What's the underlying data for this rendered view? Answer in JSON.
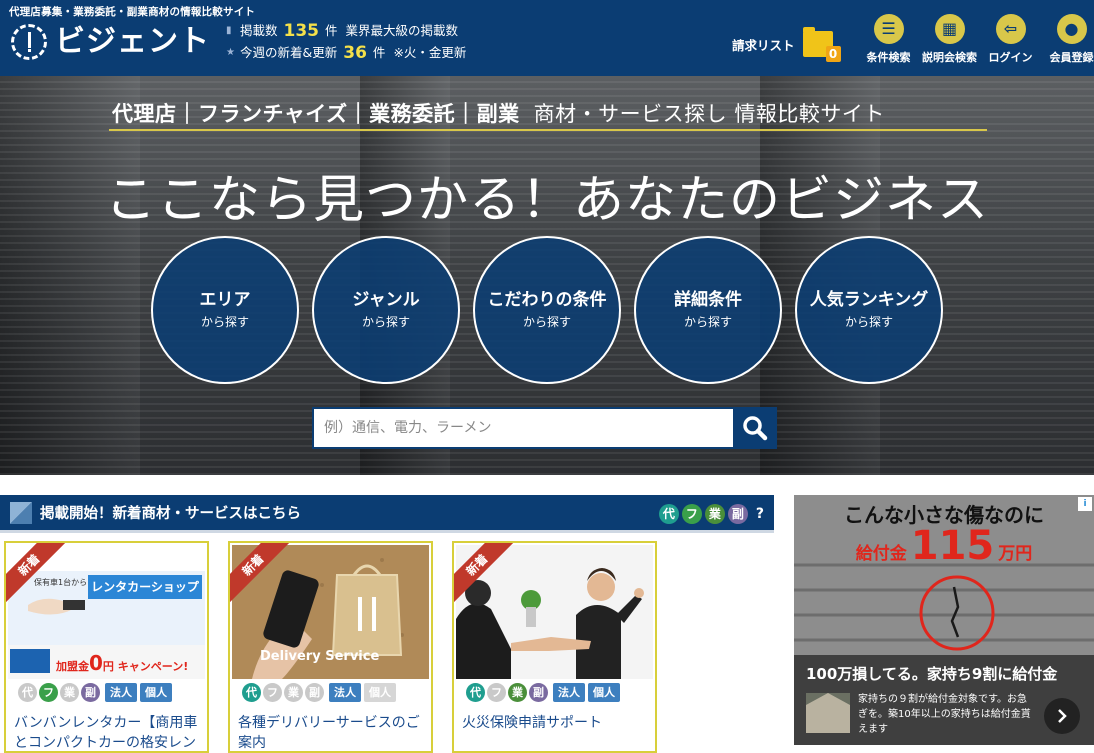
{
  "header": {
    "tagline": "代理店募集・業務委託・副業商材の情報比較サイト",
    "logo_text": "ビジェント",
    "count_label": "掲載数",
    "count_value": "135",
    "count_unit": "件",
    "count_note": "業界最大級の掲載数",
    "weekly_label": "今週の新着&更新",
    "weekly_value": "36",
    "weekly_unit": "件",
    "weekly_note": "※火・金更新",
    "request_label": "請求リスト",
    "request_count": "0",
    "nav": [
      {
        "label": "条件検索",
        "icon": "list-icon"
      },
      {
        "label": "説明会検索",
        "icon": "calendar-icon"
      },
      {
        "label": "ログイン",
        "icon": "login-icon"
      },
      {
        "label": "会員登録",
        "icon": "user-icon"
      }
    ]
  },
  "hero": {
    "subtitle_bold": "代理店｜フランチャイズ｜業務委託｜副業",
    "subtitle_light": "商材・サービス探し 情報比較サイト",
    "title": "ここなら見つかる！あなたのビジネス",
    "circles": [
      {
        "title": "エリア",
        "sub": "から探す"
      },
      {
        "title": "ジャンル",
        "sub": "から探す"
      },
      {
        "title": "こだわりの条件",
        "sub": "から探す"
      },
      {
        "title": "詳細条件",
        "sub": "から探す"
      },
      {
        "title": "人気ランキング",
        "sub": "から探す"
      }
    ],
    "search_placeholder": "例）通信、電力、ラーメン"
  },
  "new_section": {
    "title": "掲載開始！新着商材・サービスはこちら",
    "tags": [
      "代",
      "フ",
      "業",
      "副"
    ],
    "help": "?"
  },
  "cards": [
    {
      "ribbon": "新着",
      "title": "バンバンレンタカー【商用車とコンパクトカーの格安レン",
      "img_text_1": "保有車1台から",
      "img_text_2": "レンタカーショップ",
      "img_text_3": "加盟金",
      "img_text_4": "0",
      "img_text_5": "円 キャンペーン!",
      "tags": [
        "代",
        "フ",
        "業",
        "副"
      ],
      "labels": [
        "法人",
        "個人"
      ]
    },
    {
      "ribbon": "新着",
      "title": "各種デリバリーサービスのご案内",
      "img_text_1": "Delivery Service",
      "tags": [
        "代",
        "フ",
        "業",
        "副"
      ],
      "labels": [
        "法人",
        "個人"
      ]
    },
    {
      "ribbon": "新着",
      "title": "火災保険申請サポート",
      "tags": [
        "代",
        "フ",
        "業",
        "副"
      ],
      "labels": [
        "法人",
        "個人"
      ]
    }
  ],
  "ad": {
    "headline": "こんな小さな傷なのに",
    "sub_prefix": "給付金",
    "sub_num": "115",
    "sub_unit": "万円",
    "caption": "100万損してる。家持ち9割に給付金",
    "body": "家持ちの９割が給付金対象です。お急ぎを。築10年以上の家持ちは給付金貰えます"
  },
  "colors": {
    "navy": "#0b3d73",
    "gold": "#d8c74a",
    "yellow": "#f4e04a",
    "teal": "#1f9e8f",
    "green": "#3aa04a",
    "purple": "#7a6aa0",
    "label_blue": "#3d7fbf",
    "ribbon_red": "#c0392b"
  }
}
